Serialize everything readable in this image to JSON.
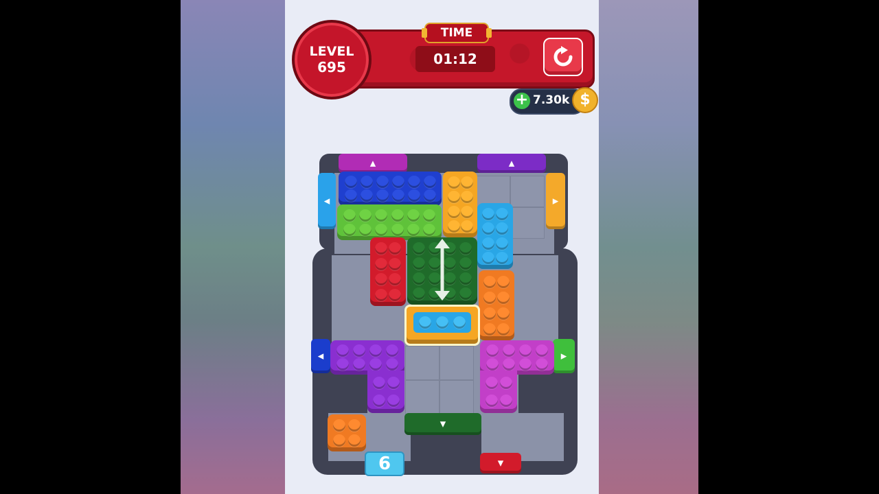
{
  "hud": {
    "level_label": "LEVEL",
    "level_number": "695",
    "time_label": "TIME",
    "time_value": "01:12",
    "coins": "7.30k",
    "coin_plus": "+",
    "coin_symbol": "$"
  },
  "counter": {
    "moves_value": "6"
  },
  "colors": {
    "blue": "#1f3fcf",
    "orange_yellow": "#f5a623",
    "green": "#5fc23a",
    "sky": "#29a6e6",
    "red": "#d21b2b",
    "dark_green": "#1f6b2a",
    "orange": "#f07a22",
    "purple": "#8a2fd0",
    "magenta": "#c23fc8"
  },
  "icons": [
    "restart-icon",
    "plus-icon",
    "coin-icon",
    "drag-arrow-icon"
  ]
}
